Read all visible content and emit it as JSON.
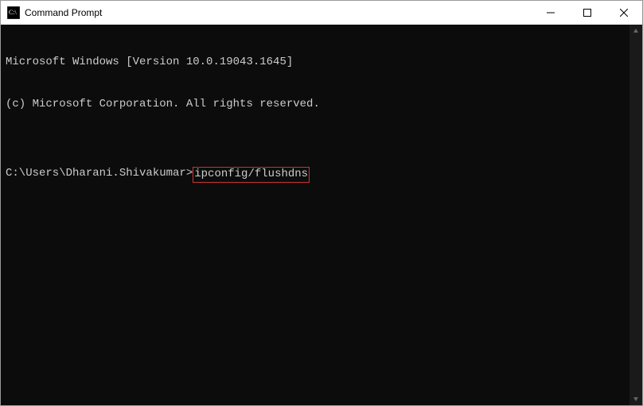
{
  "window": {
    "title": "Command Prompt"
  },
  "terminal": {
    "line1": "Microsoft Windows [Version 10.0.19043.1645]",
    "line2": "(c) Microsoft Corporation. All rights reserved.",
    "blank": "",
    "prompt": "C:\\Users\\Dharani.Shivakumar>",
    "command": "ipconfig/flushdns"
  },
  "highlight": {
    "color": "#cc3333"
  }
}
